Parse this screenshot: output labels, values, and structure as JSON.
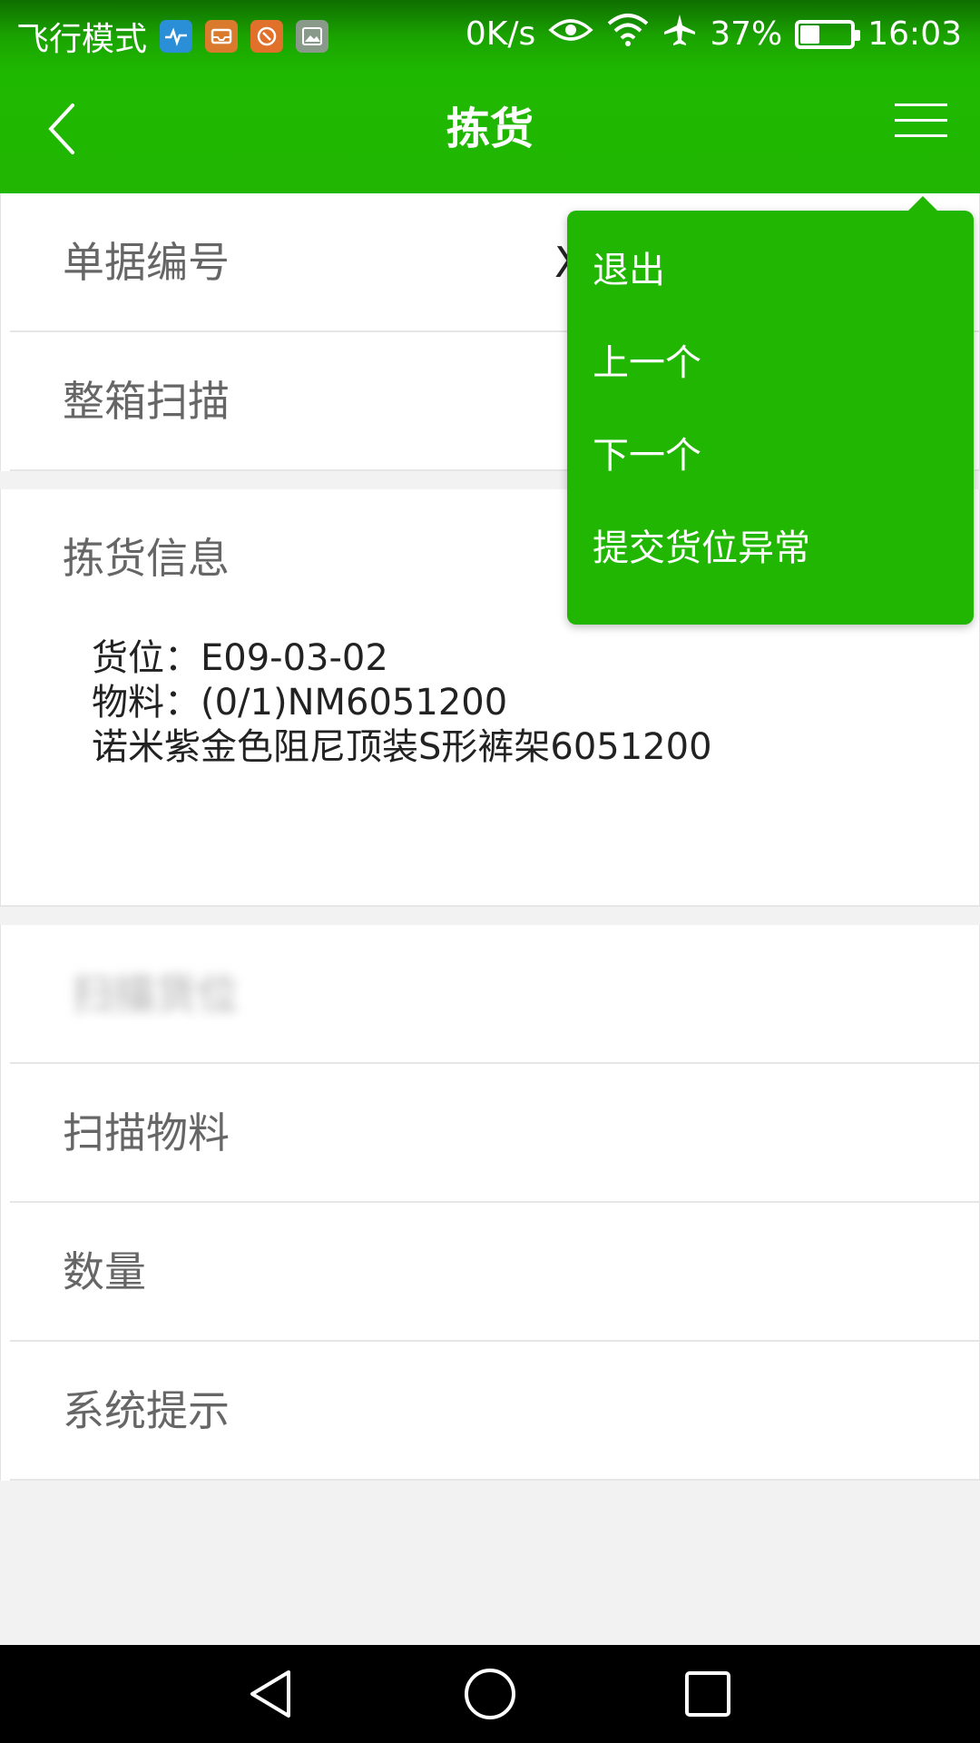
{
  "status_bar": {
    "carrier": "飞行模式",
    "speed": "0K/s",
    "battery_pct": "37%",
    "battery_level": 0.37,
    "time": "16:03",
    "app_icons": [
      "health-app-icon",
      "inbox-app-icon",
      "circle-app-icon",
      "gallery-app-icon"
    ],
    "app_icon_colors": [
      "#2a8fd6",
      "#d97a2c",
      "#e0702a",
      "#8a9a8a"
    ]
  },
  "header": {
    "title": "拣货",
    "back_icon": "chevron-left-icon",
    "menu_icon": "hamburger-menu-icon",
    "accent": "#21b602"
  },
  "form": {
    "doc_number_label": "单据编号",
    "doc_number_value": "X",
    "box_scan_label": "整箱扫描",
    "picking_info_label": "拣货信息",
    "location_line": "货位：E09-03-02",
    "material_line": "物料：(0/1)NM6051200",
    "material_desc_line": "诺米紫金色阻尼顶装S形裤架6051200",
    "blurred_row_label": "扫描货位",
    "scan_material_label": "扫描物料",
    "quantity_label": "数量",
    "system_tip_label": "系统提示"
  },
  "dropdown_menu": {
    "items": [
      "退出",
      "上一个",
      "下一个",
      "提交货位异常"
    ]
  },
  "nav_bar": {
    "back": "triangle-back-icon",
    "home": "circle-home-icon",
    "recents": "square-recents-icon"
  }
}
